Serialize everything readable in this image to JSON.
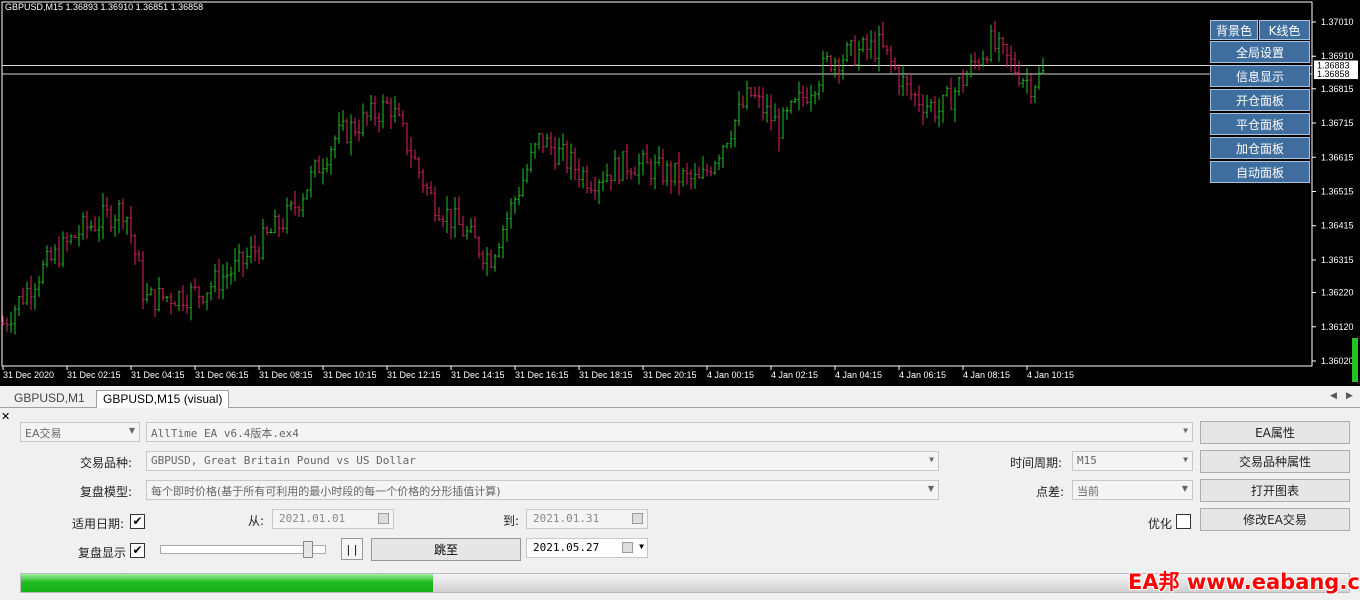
{
  "chart": {
    "header": "GBPUSD,M15  1.36893 1.36910 1.36851 1.36858",
    "price_ticks": [
      "1.37010",
      "1.36910",
      "1.36815",
      "1.36715",
      "1.36615",
      "1.36515",
      "1.36415",
      "1.36315",
      "1.36220",
      "1.36120",
      "1.36020"
    ],
    "price_tags": [
      "1.36883",
      "1.36858"
    ],
    "time_ticks": [
      "31 Dec 2020",
      "31 Dec 02:15",
      "31 Dec 04:15",
      "31 Dec 06:15",
      "31 Dec 08:15",
      "31 Dec 10:15",
      "31 Dec 12:15",
      "31 Dec 14:15",
      "31 Dec 16:15",
      "31 Dec 18:15",
      "31 Dec 20:15",
      "4 Jan 00:15",
      "4 Jan 02:15",
      "4 Jan 04:15",
      "4 Jan 06:15",
      "4 Jan 08:15",
      "4 Jan 10:15"
    ],
    "colors": {
      "bull": "#22c322",
      "bear": "#e0245e",
      "background": "#000000",
      "axis": "#ffffff"
    },
    "buttons": {
      "background_color": "背景色",
      "candle_color": "K线色",
      "side": [
        "全局设置",
        "信息显示",
        "开仓面板",
        "平仓面板",
        "加仓面板",
        "自动面板"
      ]
    }
  },
  "tabs": [
    "GBPUSD,M1",
    "GBPUSD,M15 (visual)"
  ],
  "tester": {
    "mode": "EA交易",
    "expert": "AllTime EA v6.4版本.ex4",
    "symbol_label": "交易品种:",
    "symbol": "GBPUSD, Great Britain Pound vs US Dollar",
    "model_label": "复盘模型:",
    "model": "每个即时价格(基于所有可利用的最小时段的每一个价格的分形插值计算)",
    "use_date_label": "适用日期:",
    "from_label": "从:",
    "from_date": "2021.01.01",
    "to_label": "到:",
    "to_date": "2021.01.31",
    "visual_label": "复盘显示",
    "pause_label": "| |",
    "skip_label": "跳至",
    "skip_date": "2021.05.27",
    "period_label": "时间周期:",
    "period": "M15",
    "spread_label": "点差:",
    "spread": "当前",
    "optimize_label": "优化",
    "buttons": [
      "EA属性",
      "交易品种属性",
      "打开图表",
      "修改EA交易"
    ],
    "progress": 0.31,
    "check_mark": "✔"
  },
  "watermark": "EA邦 www.eabang.com"
}
